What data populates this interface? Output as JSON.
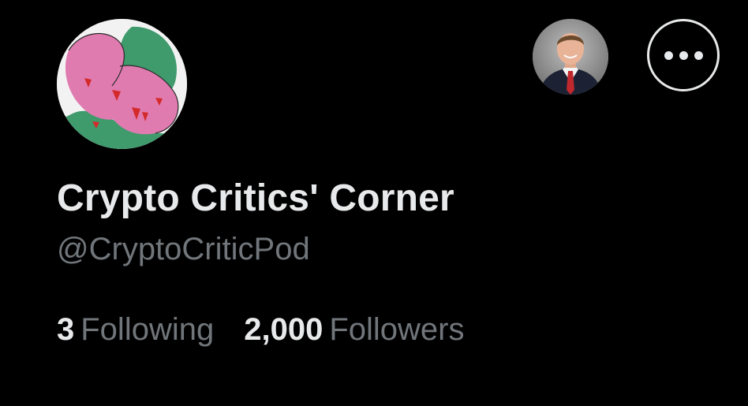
{
  "profile": {
    "display_name": "Crypto Critics' Corner",
    "handle": "@CryptoCriticPod",
    "following_count": "3",
    "following_label": "Following",
    "followers_count": "2,000",
    "followers_label": "Followers"
  },
  "icons": {
    "avatar": "profile-avatar-icon",
    "follower_avatar": "followed-by-avatar-icon",
    "more": "more-options-icon"
  },
  "colors": {
    "background": "#000000",
    "primary_text": "#e7e9ea",
    "secondary_text": "#71767b",
    "avatar_pink": "#e07bb0",
    "avatar_green": "#3f9a6c",
    "avatar_red": "#d42a2a"
  }
}
